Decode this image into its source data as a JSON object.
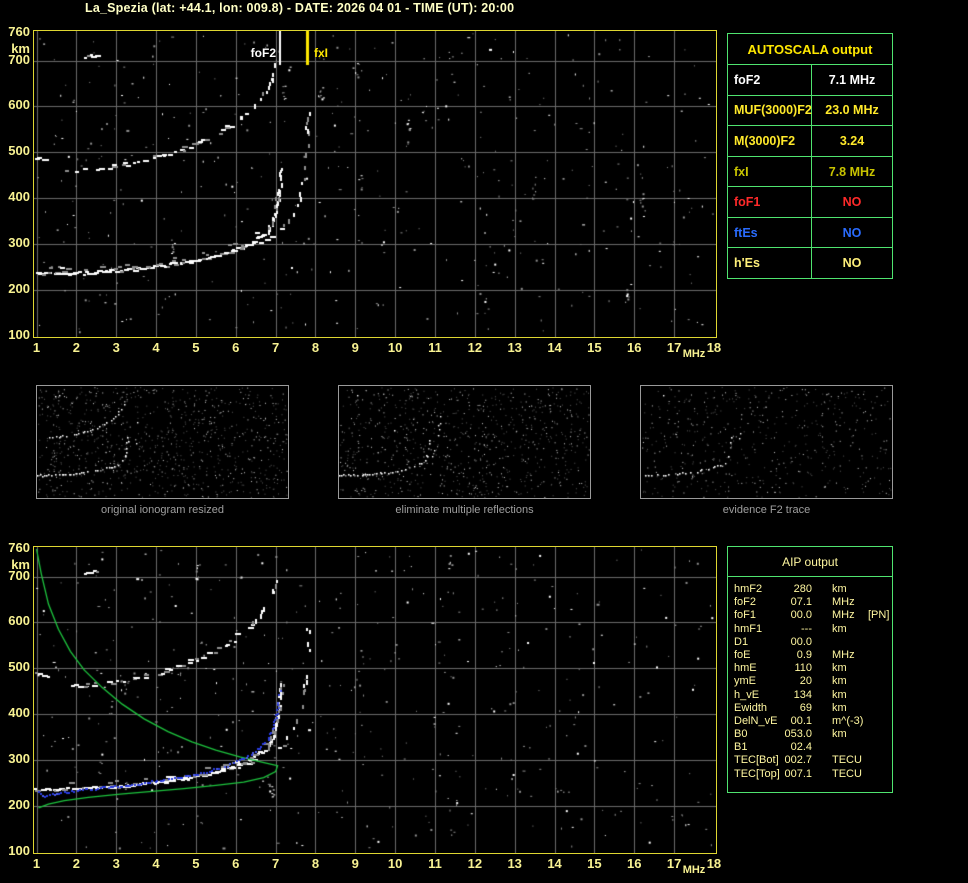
{
  "title": "La_Spezia (lat: +44.1, lon: 009.8) - DATE: 2026 04 01 - TIME (UT): 20:00",
  "colors": {
    "background": "#000000",
    "title_text": "#ffffc4",
    "plot_border": "#ded631",
    "axis_labels": "#f8f292",
    "grid": "#6b6b6b",
    "trace_white": "#ffffff",
    "trace_gray": "#8f8f8f",
    "table_border": "#4fe46f",
    "table_header_yellow": "#ffe800",
    "green_profile": "#1dc53e",
    "blue_fit": "#2a3ce0",
    "caption_gray": "#9f9f9f"
  },
  "autoscala_table": {
    "title": "AUTOSCALA output",
    "rows": [
      {
        "label": "foF2",
        "value": "7.1 MHz",
        "color": "#ffffff"
      },
      {
        "label": "MUF(3000)F2",
        "value": "23.0 MHz",
        "color": "#ffe92a"
      },
      {
        "label": "M(3000)F2",
        "value": "3.24",
        "color": "#ffe92a"
      },
      {
        "label": "fxI",
        "value": "7.8 MHz",
        "color": "#c9c400"
      },
      {
        "label": "foF1",
        "value": "NO",
        "color": "#ff2a2a"
      },
      {
        "label": "ftEs",
        "value": "NO",
        "color": "#2a6cff"
      },
      {
        "label": "h'Es",
        "value": "NO",
        "color": "#fff07a"
      }
    ]
  },
  "aip_table": {
    "title": "AIP output",
    "rows": [
      {
        "label": "hmF2",
        "value": "280",
        "unit": "km",
        "note": ""
      },
      {
        "label": "foF2",
        "value": "07.1",
        "unit": "MHz",
        "note": ""
      },
      {
        "label": "foF1",
        "value": "00.0",
        "unit": "MHz",
        "note": "[PN]"
      },
      {
        "label": "hmF1",
        "value": "---",
        "unit": "km",
        "note": ""
      },
      {
        "label": "D1",
        "value": "00.0",
        "unit": "",
        "note": ""
      },
      {
        "label": "foE",
        "value": "0.9",
        "unit": "MHz",
        "note": ""
      },
      {
        "label": "hmE",
        "value": "110",
        "unit": "km",
        "note": ""
      },
      {
        "label": "ymE",
        "value": "20",
        "unit": "km",
        "note": ""
      },
      {
        "label": "h_vE",
        "value": "134",
        "unit": "km",
        "note": ""
      },
      {
        "label": "Ewidth",
        "value": "69",
        "unit": "km",
        "note": ""
      },
      {
        "label": "DelN_vE",
        "value": "00.1",
        "unit": "m^(-3)",
        "note": ""
      },
      {
        "label": "B0",
        "value": "053.0",
        "unit": "km",
        "note": ""
      },
      {
        "label": "B1",
        "value": "02.4",
        "unit": "",
        "note": ""
      },
      {
        "label": "TEC[Bot]",
        "value": "002.7",
        "unit": "TECU",
        "note": ""
      },
      {
        "label": "TEC[Top]",
        "value": "007.1",
        "unit": "TECU",
        "note": ""
      }
    ]
  },
  "thumbnails": [
    {
      "caption": "original ionogram resized"
    },
    {
      "caption": "eliminate multiple reflections"
    },
    {
      "caption": "evidence F2 trace"
    }
  ],
  "chart_data": {
    "type": "scatter",
    "xlabel": "MHz",
    "ylabel": "km",
    "xlim": [
      1,
      18
    ],
    "ylim": [
      100,
      760
    ],
    "grid": true,
    "xticks": [
      "1",
      "2",
      "3",
      "4",
      "5",
      "6",
      "7",
      "8",
      "9",
      "10",
      "11",
      "12",
      "13",
      "14",
      "15",
      "16",
      "17",
      "18"
    ],
    "yticks": [
      "760",
      "700",
      "600",
      "500",
      "400",
      "300",
      "200",
      "100"
    ],
    "markers": [
      {
        "label": "foF2",
        "x_mhz": 7.1,
        "color": "#ffffff"
      },
      {
        "label": "fxI",
        "x_mhz": 7.8,
        "color": "#ffe800"
      }
    ],
    "echo_traces": {
      "f2_o_mode": [
        [
          1.0,
          234
        ],
        [
          1.6,
          235
        ],
        [
          2.2,
          237
        ],
        [
          2.8,
          240
        ],
        [
          3.4,
          244
        ],
        [
          4.0,
          250
        ],
        [
          4.6,
          257
        ],
        [
          5.1,
          265
        ],
        [
          5.6,
          275
        ],
        [
          6.0,
          286
        ],
        [
          6.35,
          298
        ],
        [
          6.6,
          311
        ],
        [
          6.8,
          327
        ],
        [
          6.93,
          345
        ],
        [
          7.02,
          368
        ],
        [
          7.08,
          395
        ],
        [
          7.12,
          425
        ],
        [
          7.15,
          458
        ],
        [
          7.16,
          472
        ]
      ],
      "f2_x_mode": [
        [
          5.9,
          283
        ],
        [
          6.3,
          292
        ],
        [
          6.7,
          305
        ],
        [
          7.0,
          320
        ],
        [
          7.25,
          340
        ],
        [
          7.45,
          365
        ],
        [
          7.6,
          395
        ],
        [
          7.7,
          430
        ],
        [
          7.76,
          470
        ],
        [
          7.8,
          510
        ],
        [
          7.82,
          560
        ],
        [
          7.83,
          615
        ]
      ],
      "second_hop": [
        [
          1.8,
          458
        ],
        [
          2.3,
          462
        ],
        [
          2.9,
          468
        ],
        [
          3.5,
          477
        ],
        [
          4.1,
          490
        ],
        [
          4.7,
          506
        ],
        [
          5.2,
          524
        ],
        [
          5.7,
          546
        ],
        [
          6.1,
          570
        ],
        [
          6.45,
          596
        ],
        [
          6.7,
          624
        ],
        [
          6.9,
          655
        ],
        [
          7.0,
          685
        ],
        [
          7.05,
          702
        ]
      ],
      "stray": [
        [
          2.25,
          706
        ],
        [
          2.6,
          714
        ]
      ],
      "stray2": [
        [
          1.02,
          487
        ],
        [
          1.35,
          480
        ]
      ]
    },
    "profile_panel": {
      "electron_density_profile_green": [
        [
          1.0,
          760
        ],
        [
          1.12,
          706
        ],
        [
          1.3,
          640
        ],
        [
          1.55,
          585
        ],
        [
          1.85,
          537
        ],
        [
          2.2,
          496
        ],
        [
          2.65,
          458
        ],
        [
          3.15,
          422
        ],
        [
          3.7,
          390
        ],
        [
          4.3,
          362
        ],
        [
          4.9,
          340
        ],
        [
          5.5,
          322
        ],
        [
          6.1,
          307
        ],
        [
          6.6,
          297
        ],
        [
          6.9,
          291
        ],
        [
          7.05,
          288
        ],
        [
          7.0,
          275
        ],
        [
          6.7,
          262
        ],
        [
          6.2,
          252
        ],
        [
          5.5,
          245
        ],
        [
          4.7,
          238
        ],
        [
          3.9,
          232
        ],
        [
          3.1,
          226
        ],
        [
          2.3,
          219
        ],
        [
          1.7,
          212
        ],
        [
          1.3,
          204
        ],
        [
          1.05,
          196
        ]
      ],
      "autoscaled_trace_blue": [
        [
          1.05,
          231
        ],
        [
          1.2,
          221
        ],
        [
          1.4,
          224
        ],
        [
          1.7,
          229
        ],
        [
          2.1,
          234
        ],
        [
          2.6,
          239
        ],
        [
          3.1,
          243
        ],
        [
          3.6,
          248
        ],
        [
          4.1,
          254
        ],
        [
          4.6,
          261
        ],
        [
          5.0,
          268
        ],
        [
          5.4,
          277
        ],
        [
          5.8,
          288
        ],
        [
          6.1,
          299
        ],
        [
          6.4,
          312
        ],
        [
          6.6,
          326
        ],
        [
          6.8,
          344
        ],
        [
          6.93,
          366
        ],
        [
          7.02,
          392
        ],
        [
          7.07,
          418
        ],
        [
          7.1,
          442
        ],
        [
          7.12,
          457
        ]
      ]
    }
  }
}
